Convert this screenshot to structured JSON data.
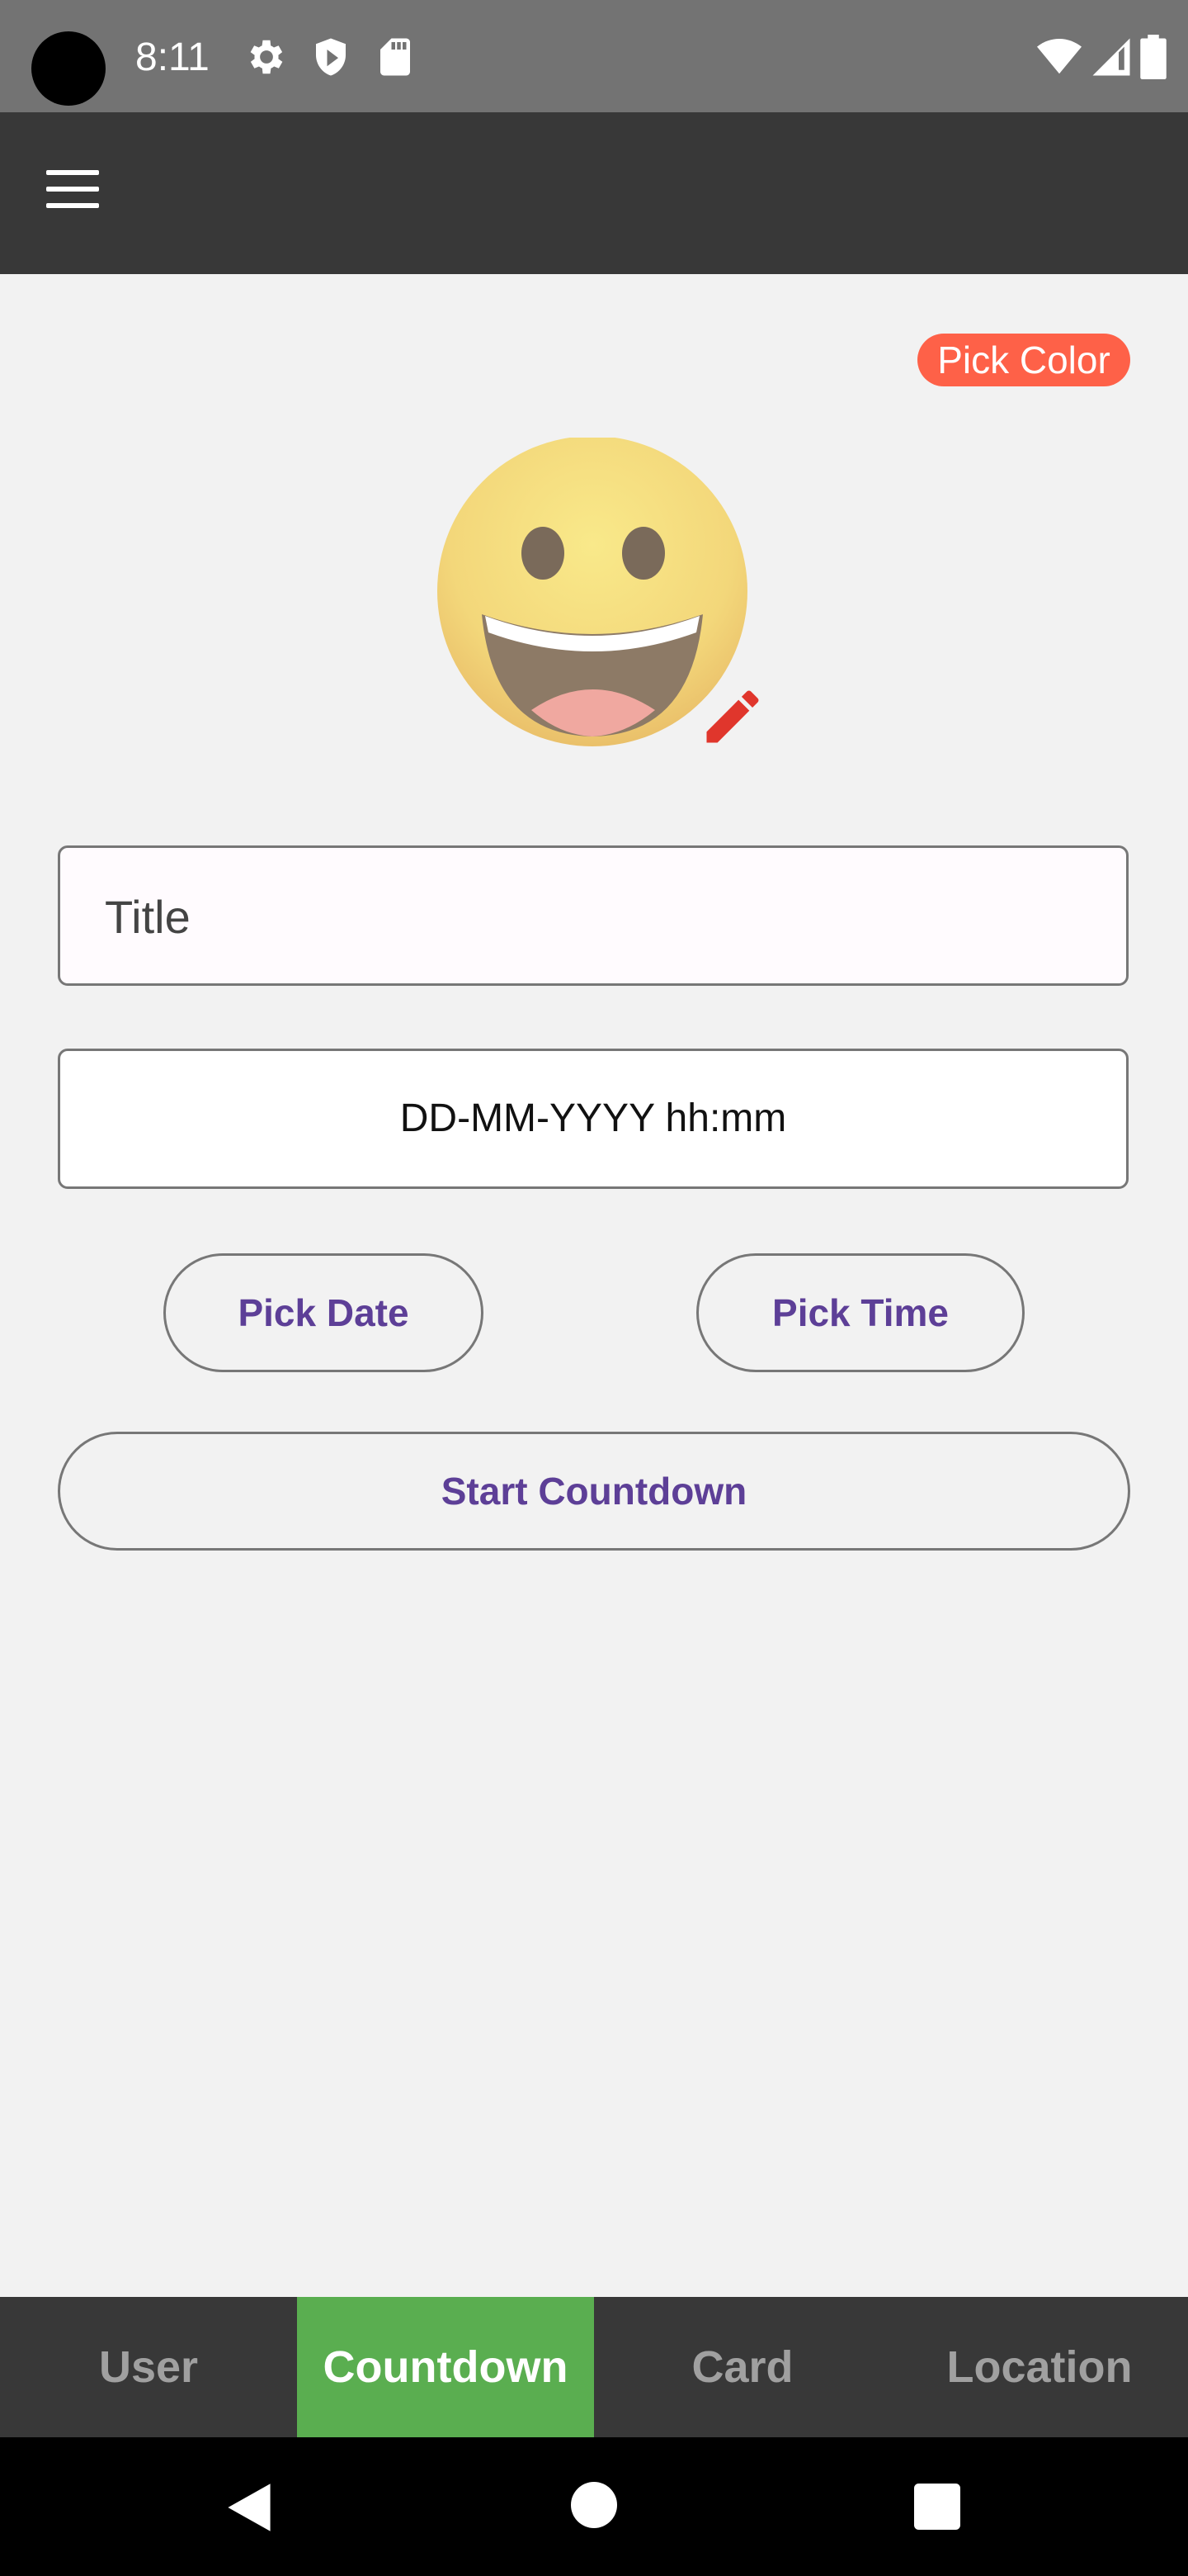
{
  "status_bar": {
    "time": "8:11",
    "icons": [
      "gear-icon",
      "shield-icon",
      "sd-card-icon",
      "wifi-icon",
      "signal-icon",
      "battery-icon"
    ]
  },
  "app_bar": {
    "menu_icon": "hamburger-menu-icon"
  },
  "content": {
    "pick_color_label": "Pick Color",
    "emoji_icon": "grinning-face-emoji",
    "edit_icon": "pencil-icon",
    "title_placeholder": "Title",
    "datetime_text": "DD-MM-YYYY hh:mm",
    "pick_date_label": "Pick Date",
    "pick_time_label": "Pick Time",
    "start_label": "Start Countdown"
  },
  "tabs": [
    {
      "label": "User",
      "active": false
    },
    {
      "label": "Countdown",
      "active": true
    },
    {
      "label": "Card",
      "active": false
    },
    {
      "label": "Location",
      "active": false
    }
  ],
  "nav_bar": {
    "icons": [
      "back-icon",
      "home-icon",
      "recents-icon"
    ]
  },
  "colors": {
    "status_bar": "#737373",
    "app_bar": "#383838",
    "pick_color": "#fe6148",
    "accent_text": "#5d3f97",
    "active_tab": "#5aae50",
    "edit_pencil": "#e0362c"
  }
}
